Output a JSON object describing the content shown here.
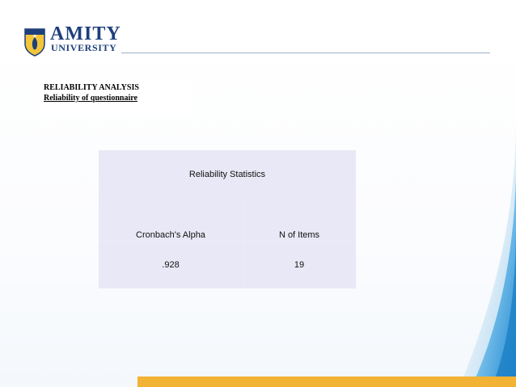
{
  "header": {
    "logo_name": "AMITY",
    "logo_sub": "UNIVERSITY"
  },
  "slide": {
    "title": "RELIABILITY ANALYSIS",
    "subtitle": "Reliability of questionnaire"
  },
  "table": {
    "title": "Reliability Statistics",
    "columns": [
      "Cronbach's Alpha",
      "N of Items"
    ],
    "rows": [
      [
        ".928",
        "19"
      ]
    ]
  },
  "colors": {
    "brand_blue": "#1d3f7a",
    "accent_orange": "#f2b233",
    "table_bg": "#e8e8f6",
    "decor_blue": "#2f97d8"
  }
}
